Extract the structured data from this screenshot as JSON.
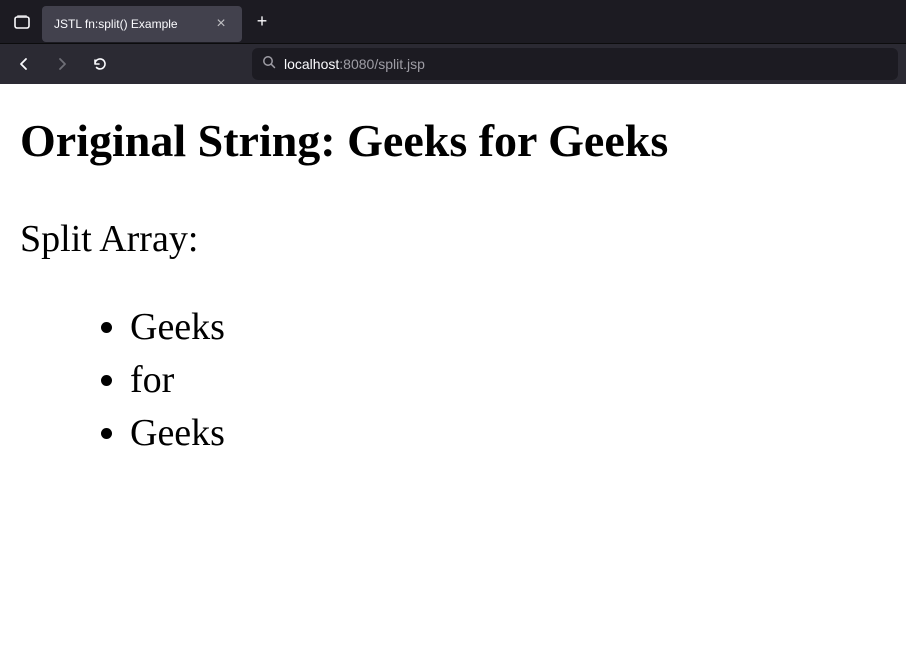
{
  "browser": {
    "tab": {
      "title": "JSTL fn:split() Example"
    },
    "url": {
      "host": "localhost",
      "port": ":8080",
      "path": "/split.jsp"
    }
  },
  "page": {
    "heading": "Original String: Geeks for Geeks",
    "subheading": "Split Array:",
    "items": [
      "Geeks",
      "for",
      "Geeks"
    ]
  }
}
